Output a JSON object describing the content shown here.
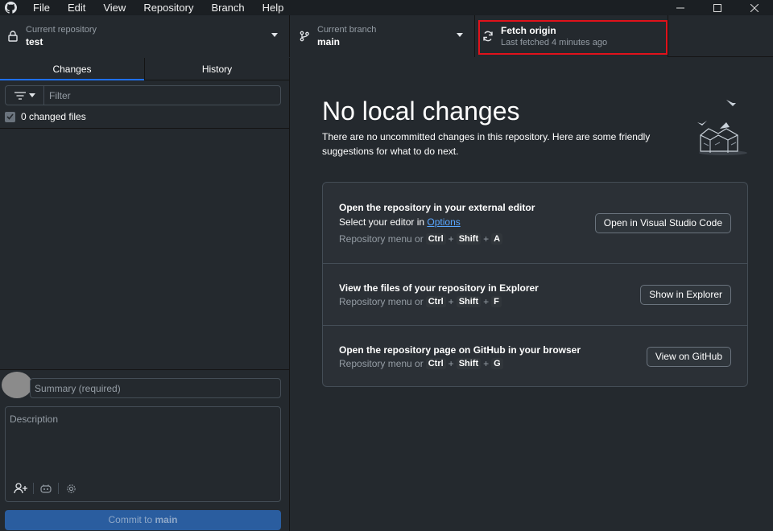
{
  "titlebar": {
    "menu": [
      "File",
      "Edit",
      "View",
      "Repository",
      "Branch",
      "Help"
    ]
  },
  "toolbar": {
    "repo_label": "Current repository",
    "repo_value": "test",
    "branch_label": "Current branch",
    "branch_value": "main",
    "fetch_title": "Fetch origin",
    "fetch_sub": "Last fetched 4 minutes ago"
  },
  "sidebar": {
    "tabs": [
      "Changes",
      "History"
    ],
    "filter_placeholder": "Filter",
    "changed_files": "0 changed files",
    "summary_placeholder": "Summary (required)",
    "description_placeholder": "Description",
    "commit_prefix": "Commit to ",
    "commit_branch": "main"
  },
  "main": {
    "title": "No local changes",
    "intro": "There are no uncommitted changes in this repository. Here are some friendly suggestions for what to do next.",
    "cards": [
      {
        "title": "Open the repository in your external editor",
        "sub_prefix": "Select your editor in ",
        "sub_link": "Options",
        "shortcut_prefix": "Repository menu or",
        "keys": [
          "Ctrl",
          "Shift",
          "A"
        ],
        "button": "Open in Visual Studio Code"
      },
      {
        "title": "View the files of your repository in Explorer",
        "shortcut_prefix": "Repository menu or",
        "keys": [
          "Ctrl",
          "Shift",
          "F"
        ],
        "button": "Show in Explorer"
      },
      {
        "title": "Open the repository page on GitHub in your browser",
        "shortcut_prefix": "Repository menu or",
        "keys": [
          "Ctrl",
          "Shift",
          "G"
        ],
        "button": "View on GitHub"
      }
    ]
  },
  "colors": {
    "accent": "#1f6feb",
    "highlight": "#e0121b",
    "link": "#58a6ff"
  }
}
